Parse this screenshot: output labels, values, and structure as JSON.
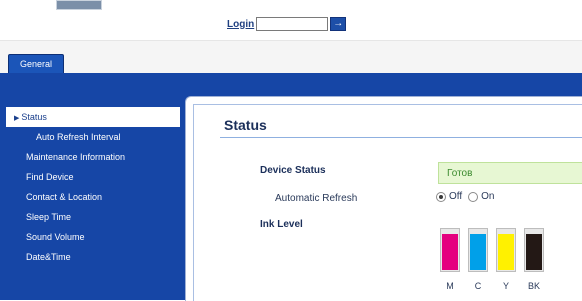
{
  "login": {
    "label": "Login",
    "value": "",
    "arrow": "→"
  },
  "tabs": [
    {
      "label": "General"
    }
  ],
  "sidebar": {
    "items": [
      {
        "label": "Status",
        "selected": true
      },
      {
        "label": "Auto Refresh Interval",
        "sub": true
      },
      {
        "label": "Maintenance Information"
      },
      {
        "label": "Find Device"
      },
      {
        "label": "Contact & Location"
      },
      {
        "label": "Sleep Time"
      },
      {
        "label": "Sound Volume"
      },
      {
        "label": "Date&Time"
      }
    ]
  },
  "main": {
    "title": "Status",
    "device_status_label": "Device Status",
    "device_status_value": "Готов",
    "auto_refresh_label": "Automatic Refresh",
    "auto_refresh_options": [
      {
        "label": "Off",
        "checked": true
      },
      {
        "label": "On",
        "checked": false
      }
    ],
    "ink_level_label": "Ink Level",
    "inks": [
      {
        "label": "M",
        "color": "#e4007f",
        "level": 0.9
      },
      {
        "label": "C",
        "color": "#00a0e9",
        "level": 0.9
      },
      {
        "label": "Y",
        "color": "#fff100",
        "level": 0.9
      },
      {
        "label": "BK",
        "color": "#231815",
        "level": 0.9
      }
    ]
  },
  "colors": {
    "brand_blue": "#1646a6",
    "status_green_bg": "#e7f7d3",
    "status_green_text": "#3b8a2e"
  }
}
